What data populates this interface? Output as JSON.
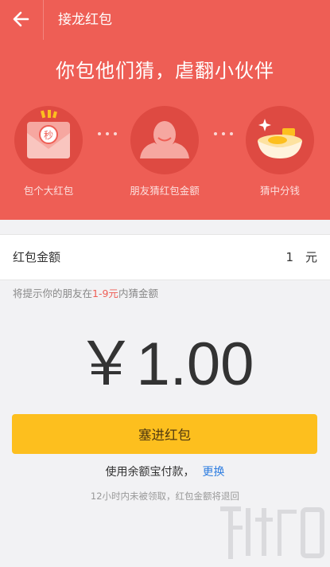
{
  "topbar": {
    "title": "接龙红包",
    "back_icon": "arrow-left-icon"
  },
  "header": {
    "slogan": "你包他们猜，虐翻小伙伴",
    "steps": [
      {
        "label": "包个大红包",
        "icon": "red-envelope-icon"
      },
      {
        "label": "朋友猜红包金额",
        "icon": "person-icon"
      },
      {
        "label": "猜中分钱",
        "icon": "gold-ingot-icon"
      }
    ],
    "envelope_char": "秒"
  },
  "amount_row": {
    "label": "红包金额",
    "value": "1",
    "unit": "元"
  },
  "hint": {
    "prefix": "将提示你的朋友在",
    "range": "1-9元",
    "suffix": "内猜金额"
  },
  "big_amount": "￥1.00",
  "submit_label": "塞进红包",
  "payment": {
    "text": "使用余额宝付款，",
    "change_label": "更换"
  },
  "notice": "12小时内未被领取，红包金额将退回",
  "colors": {
    "header_bg": "#ee5e55",
    "circle_bg": "#de4a42",
    "button_bg": "#fdbf1e",
    "link": "#2f7ee0",
    "highlight": "#ee5e55"
  }
}
